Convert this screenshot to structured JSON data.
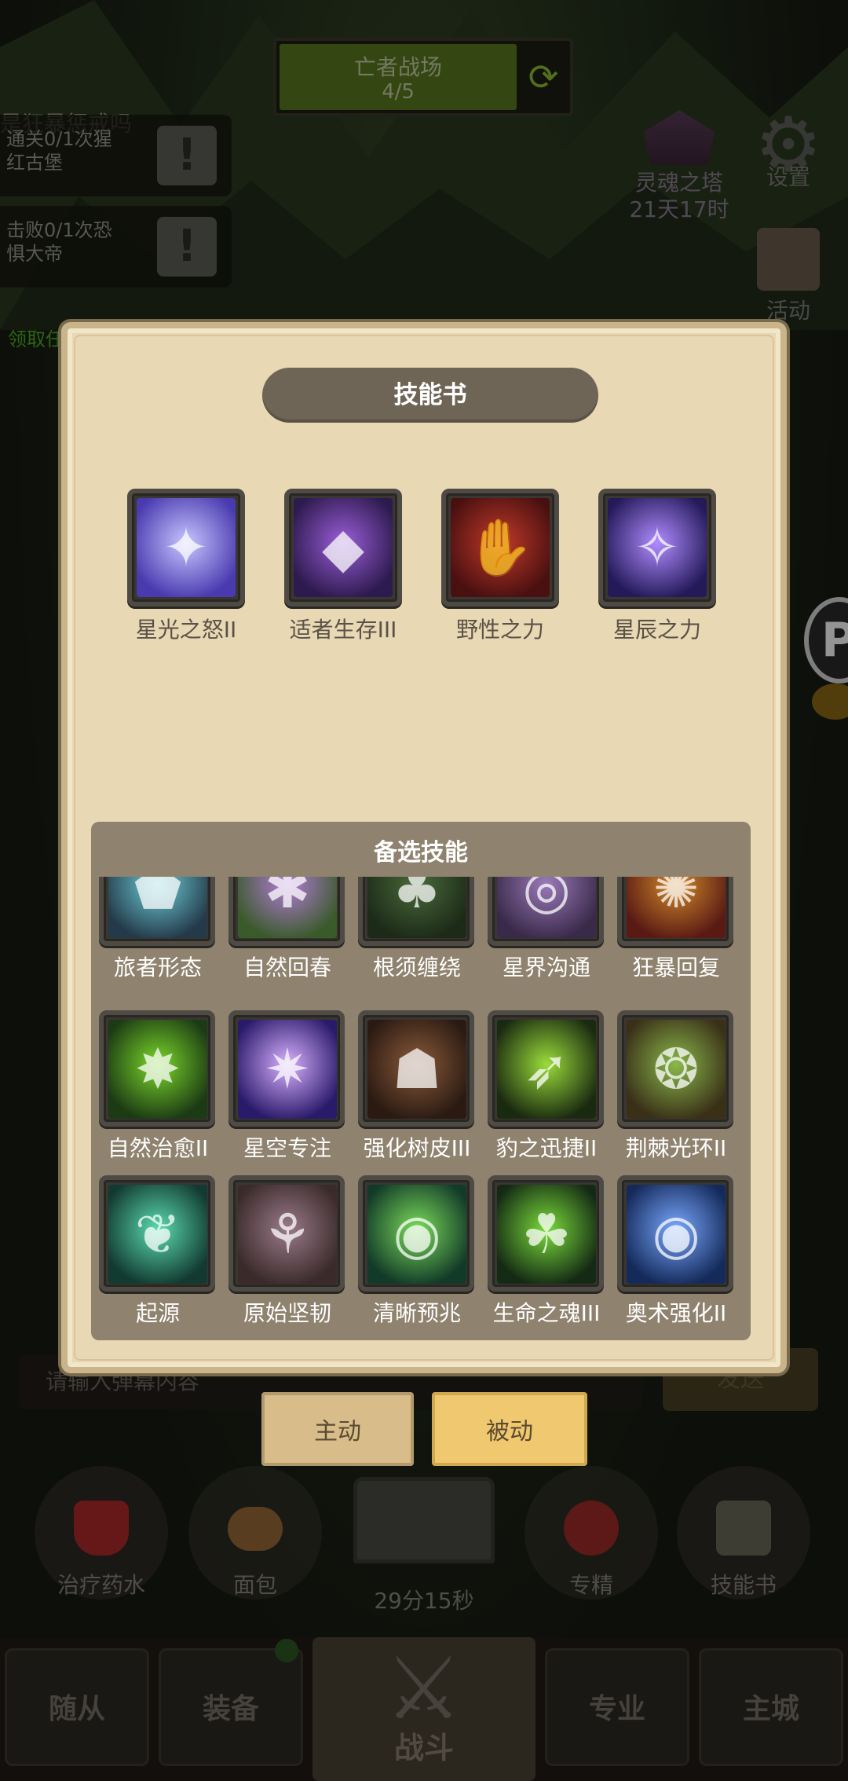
{
  "stage": {
    "title": "亡者战场",
    "progress": "4/5"
  },
  "quests": [
    {
      "line1": "通关0/1次猩",
      "line2": "红古堡"
    },
    {
      "line1": "击败0/1次恐",
      "line2": "惧大帝"
    }
  ],
  "quest_header": "是狂暴惩戒吗",
  "quest_claim": "领取任",
  "tower": {
    "name": "灵魂之塔",
    "time": "21天17时"
  },
  "settings_label": "设置",
  "activity_label": "活动",
  "right_icon_letter": "P",
  "dialog": {
    "title": "技能书",
    "equipped": [
      {
        "name": "星光之怒II",
        "icon": "starfall-icon",
        "c1": "#c7c6ff",
        "c2": "#4a3ab0"
      },
      {
        "name": "适者生存III",
        "icon": "serpent-icon",
        "c1": "#9a5ed8",
        "c2": "#2d1a4e"
      },
      {
        "name": "野性之力",
        "icon": "claw-icon",
        "c1": "#c23a2a",
        "c2": "#4a1010"
      },
      {
        "name": "星辰之力",
        "icon": "star-crystal-icon",
        "c1": "#b08cff",
        "c2": "#241a5a"
      }
    ],
    "reserve_title": "备选技能",
    "reserve": [
      {
        "name": "旅者形态",
        "icon": "travel-form-icon",
        "c1": "#6ecfd8",
        "c2": "#243a4a"
      },
      {
        "name": "自然回春",
        "icon": "rejuvenation-icon",
        "c1": "#b37cd8",
        "c2": "#3a5a2a"
      },
      {
        "name": "根须缠绕",
        "icon": "roots-icon",
        "c1": "#4a6a3a",
        "c2": "#1c2a18"
      },
      {
        "name": "星界沟通",
        "icon": "astral-icon",
        "c1": "#9a7ab8",
        "c2": "#3a2a4a"
      },
      {
        "name": "狂暴回复",
        "icon": "frenzy-icon",
        "c1": "#d08a2a",
        "c2": "#5a1a14"
      },
      {
        "name": "自然治愈II",
        "icon": "nature-heal-icon",
        "c1": "#7ad82a",
        "c2": "#1c3a14"
      },
      {
        "name": "星空专注",
        "icon": "star-focus-icon",
        "c1": "#d8b0ff",
        "c2": "#2a1a6a"
      },
      {
        "name": "强化树皮III",
        "icon": "barkskin-icon",
        "c1": "#8a5a3a",
        "c2": "#2a1a12"
      },
      {
        "name": "豹之迅捷II",
        "icon": "leopard-icon",
        "c1": "#9adc3a",
        "c2": "#1a2a10"
      },
      {
        "name": "荆棘光环II",
        "icon": "thorns-icon",
        "c1": "#8ab84a",
        "c2": "#3a3018"
      },
      {
        "name": "起源",
        "icon": "leaf-icon",
        "c1": "#5adcb0",
        "c2": "#123a30"
      },
      {
        "name": "原始坚韧",
        "icon": "primal-claw-icon",
        "c1": "#9a7a8a",
        "c2": "#3a2a2a"
      },
      {
        "name": "清晰预兆",
        "icon": "green-eye-icon",
        "c1": "#7adc5a",
        "c2": "#123a28"
      },
      {
        "name": "生命之魂III",
        "icon": "life-spirit-icon",
        "c1": "#7adc3a",
        "c2": "#142a14"
      },
      {
        "name": "奥术强化II",
        "icon": "blue-eye-icon",
        "c1": "#7aa8ff",
        "c2": "#142a5a"
      }
    ],
    "tabs": {
      "active": "主动",
      "passive": "被动"
    }
  },
  "chat": {
    "placeholder": "请输入弹幕内容",
    "send": "发送"
  },
  "consumables": [
    {
      "name": "治疗药水",
      "icon": "potion-icon",
      "color": "#b02a2a"
    },
    {
      "name": "面包",
      "icon": "bread-icon",
      "color": "#9a6a3a"
    },
    {
      "name": "专精",
      "icon": "specialization-icon",
      "color": "#a02a2a"
    },
    {
      "name": "技能书",
      "icon": "skill-book-icon",
      "color": "#6a6a5a"
    }
  ],
  "chest_timer": "29分15秒",
  "nav": {
    "followers": "随从",
    "equipment": "装备",
    "battle": "战斗",
    "profession": "专业",
    "city": "主城"
  }
}
